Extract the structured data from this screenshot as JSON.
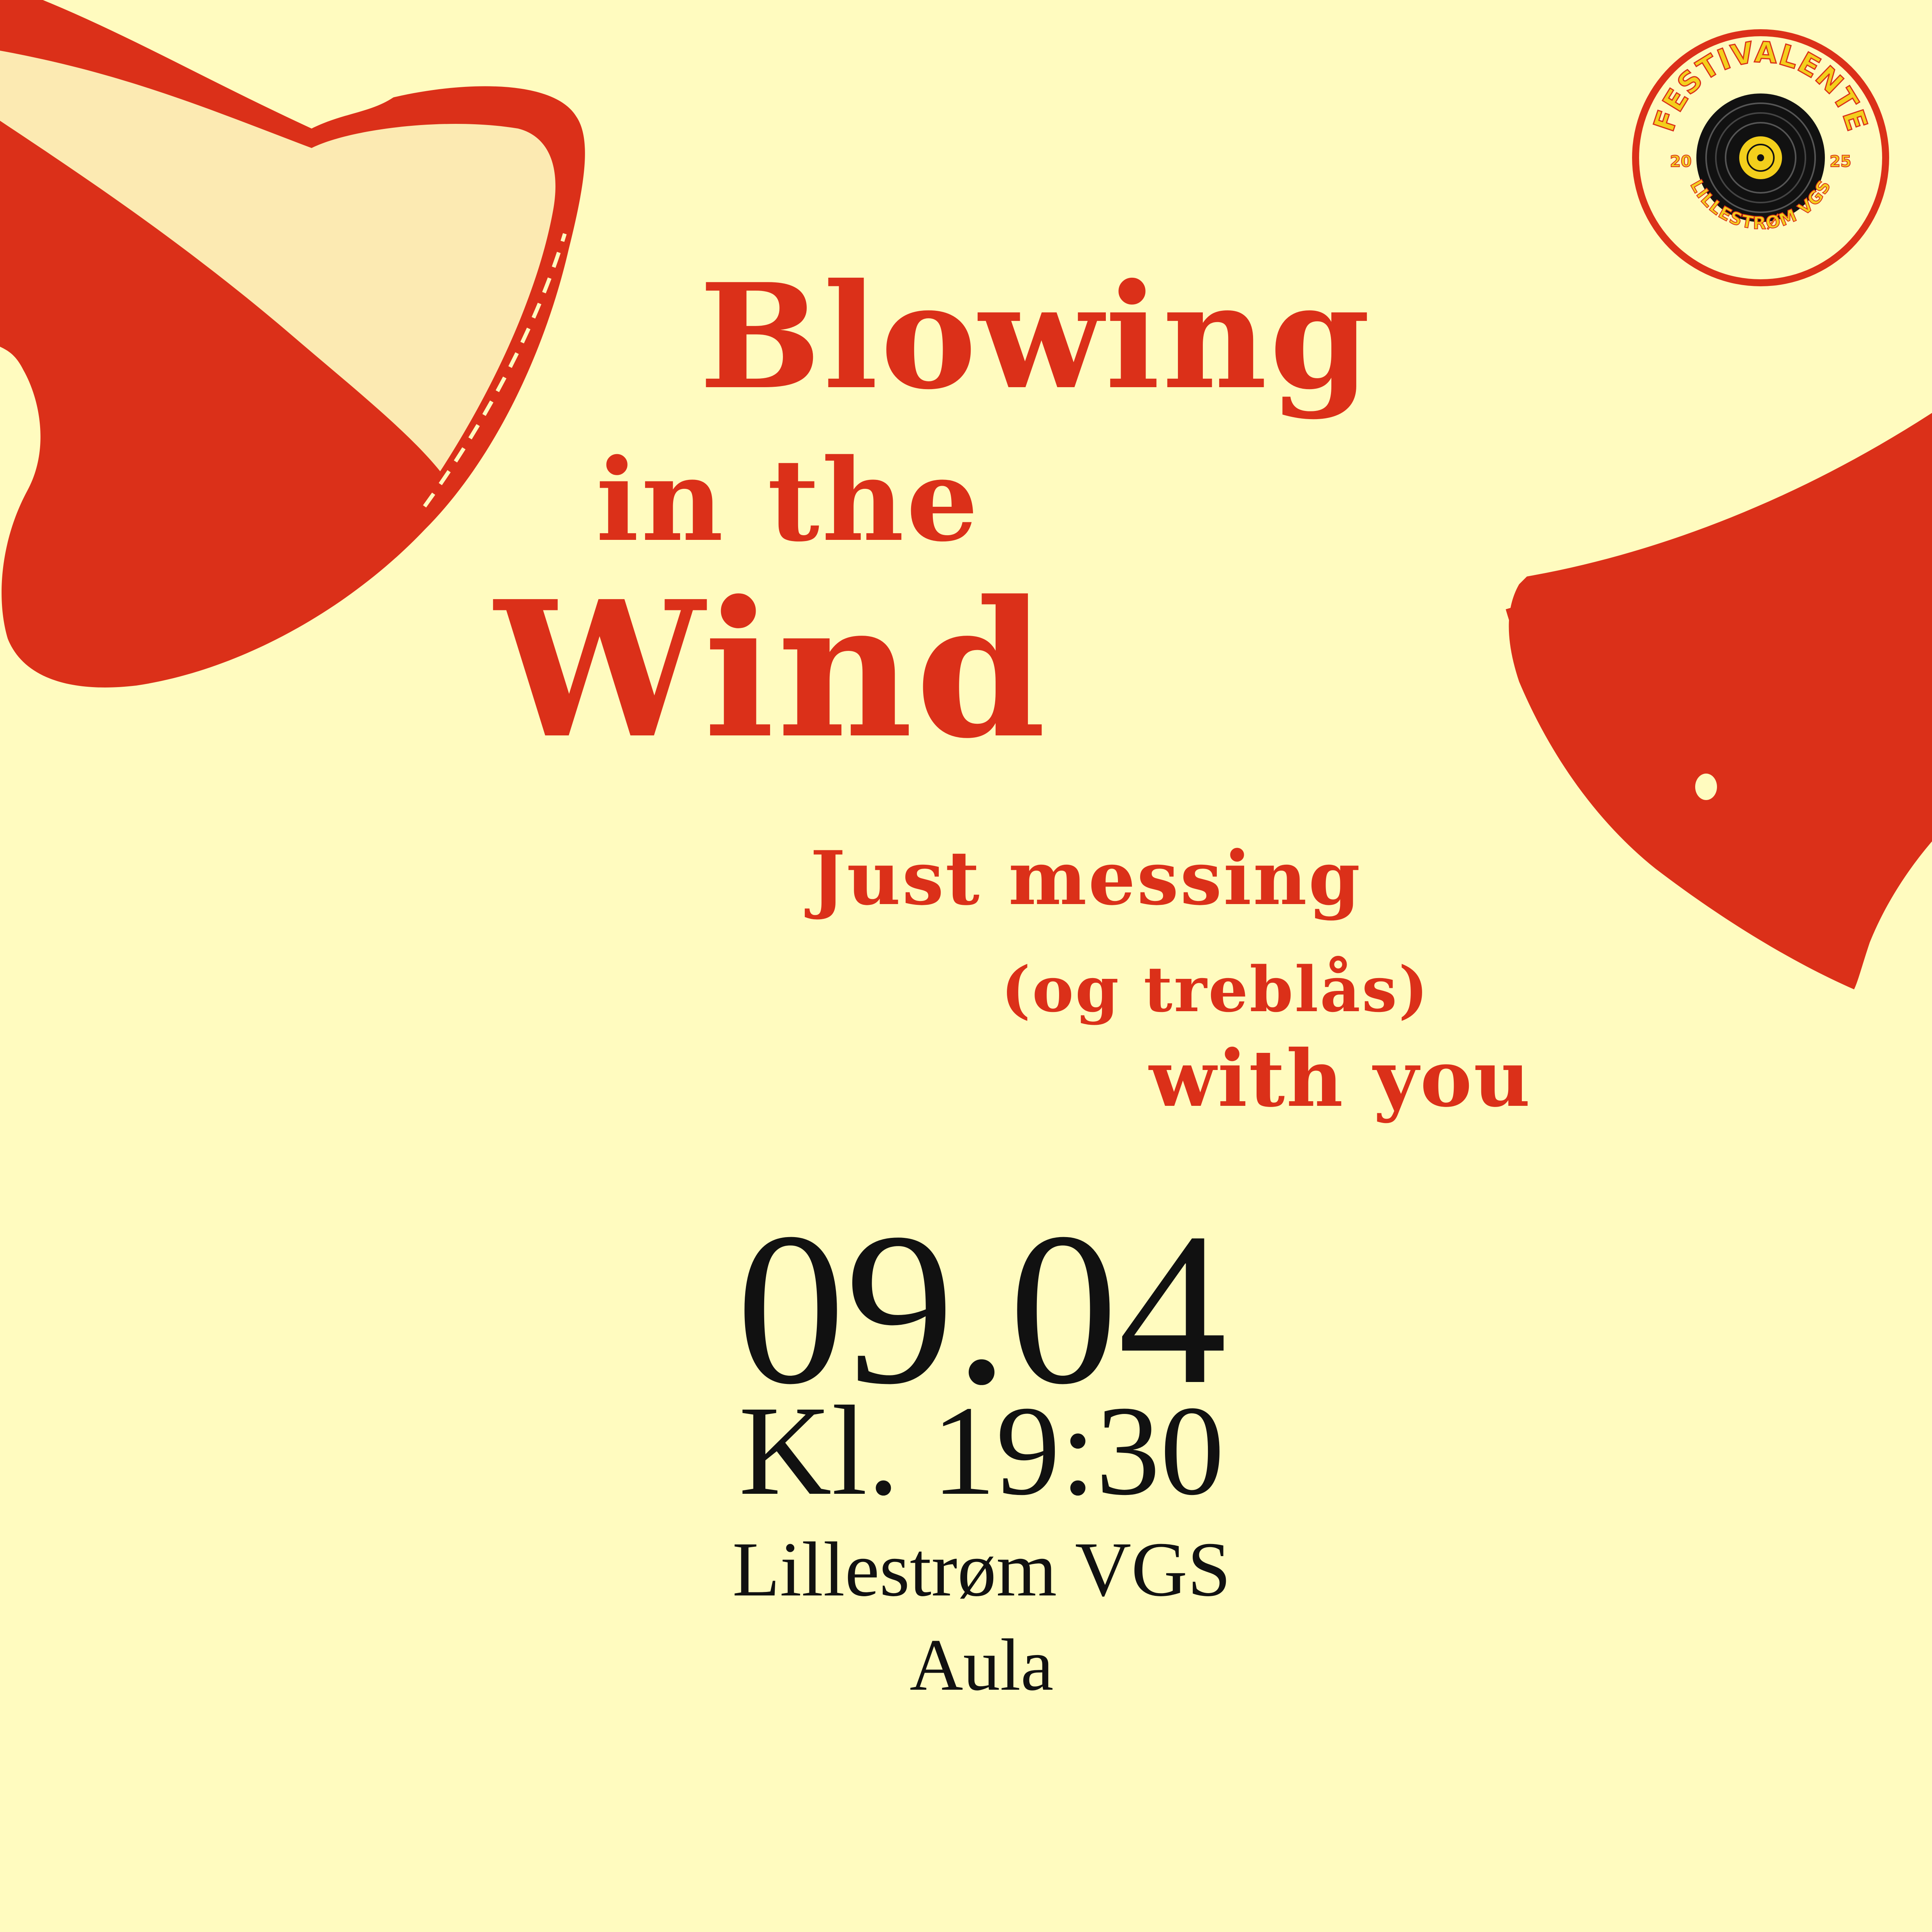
{
  "title": {
    "line1": "Blowing",
    "line2": "in the",
    "line3": "Wind"
  },
  "subtitle": {
    "line1": "Just messing",
    "line2": "(og treblås)",
    "line3": "with you"
  },
  "event": {
    "date": "09.04",
    "time": "Kl. 19:30",
    "venue": "Lillestrøm VGS",
    "room": "Aula"
  },
  "badge": {
    "name": "FESTIVALENTE",
    "year_left": "20",
    "year_right": "25",
    "school": "LILLESTRØM VGS",
    "icon": "vinyl-record-icon"
  },
  "colors": {
    "background": "#fffbbf",
    "accent_red": "#db3019",
    "badge_yellow": "#f3cf1c",
    "text_black": "#111111"
  }
}
